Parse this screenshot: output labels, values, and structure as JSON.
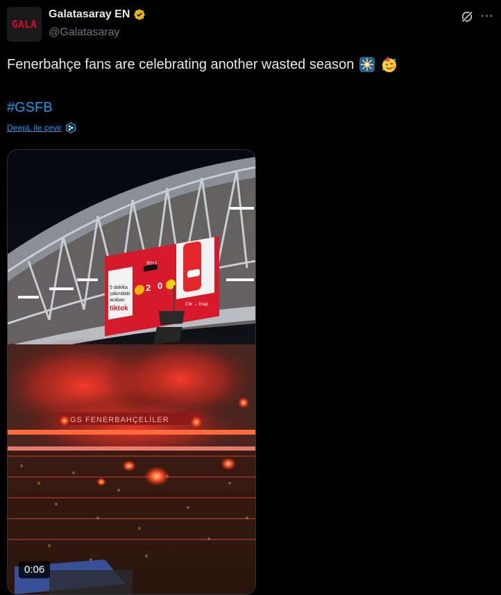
{
  "account": {
    "display_name": "Galatasaray EN",
    "handle": "@Galatasaray",
    "avatar_text": "GALA",
    "verified_color": "#e2b719"
  },
  "tweet": {
    "text": "Fenerbahçe fans are celebrating another wasted season",
    "emojis": [
      "sparkler",
      "partying-face"
    ],
    "hashtag": "#GSFB",
    "translate_label": "DeepL ile çevir"
  },
  "media": {
    "type": "video",
    "duration": "0:06",
    "scoreboard": {
      "clock": "90+1",
      "home_score": "2",
      "away_score": "0",
      "sponsor": "tiktok",
      "promo_text": [
        "5 dakika",
        "yakındaki",
        "araban"
      ],
      "side_text": "CW → Eneji"
    },
    "banner_text": "GS FENERBAHÇELİLER"
  },
  "colors": {
    "accent": "#1d9bf0",
    "background": "#000000",
    "text": "#e7e9ea",
    "muted": "#71767b"
  }
}
